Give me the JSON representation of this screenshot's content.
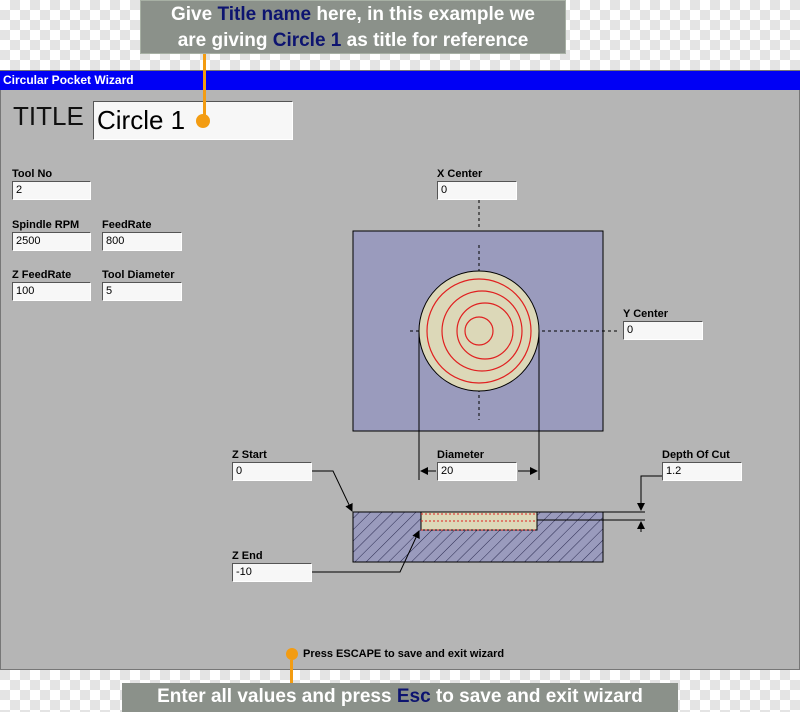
{
  "top_callout": {
    "line1_pre": "Give ",
    "line1_hl": "Title name",
    "line1_post": " here, in this example we",
    "line2_pre": "are giving ",
    "line2_hl": "Circle 1",
    "line2_post": " as title for reference"
  },
  "window": {
    "title": "Circular Pocket Wizard",
    "title_label": "TITLE",
    "title_value": "Circle 1",
    "fields": {
      "tool_no": {
        "label": "Tool No",
        "value": "2"
      },
      "spindle_rpm": {
        "label": "Spindle RPM",
        "value": "2500"
      },
      "feedrate": {
        "label": "FeedRate",
        "value": "800"
      },
      "z_feedrate": {
        "label": "Z FeedRate",
        "value": "100"
      },
      "tool_diameter": {
        "label": "Tool Diameter",
        "value": "5"
      },
      "x_center": {
        "label": "X Center",
        "value": "0"
      },
      "y_center": {
        "label": "Y Center",
        "value": "0"
      },
      "z_start": {
        "label": "Z Start",
        "value": "0"
      },
      "diameter": {
        "label": "Diameter",
        "value": "20"
      },
      "depth_of_cut": {
        "label": "Depth Of Cut",
        "value": "1.2"
      },
      "z_end": {
        "label": "Z End",
        "value": "-10"
      }
    },
    "status_text": "Press ESCAPE to save and exit wizard"
  },
  "bottom_banner": {
    "pre": "Enter all values and press ",
    "hl": "Esc",
    "post": " to save and exit wizard"
  },
  "colors": {
    "titlebar": "#0000f5",
    "annotation": "#f39c12",
    "window_bg": "#b5b5b5",
    "stock": "#9a9bbd",
    "pocket": "#dcd8b8",
    "toolpath": "#e02020"
  }
}
